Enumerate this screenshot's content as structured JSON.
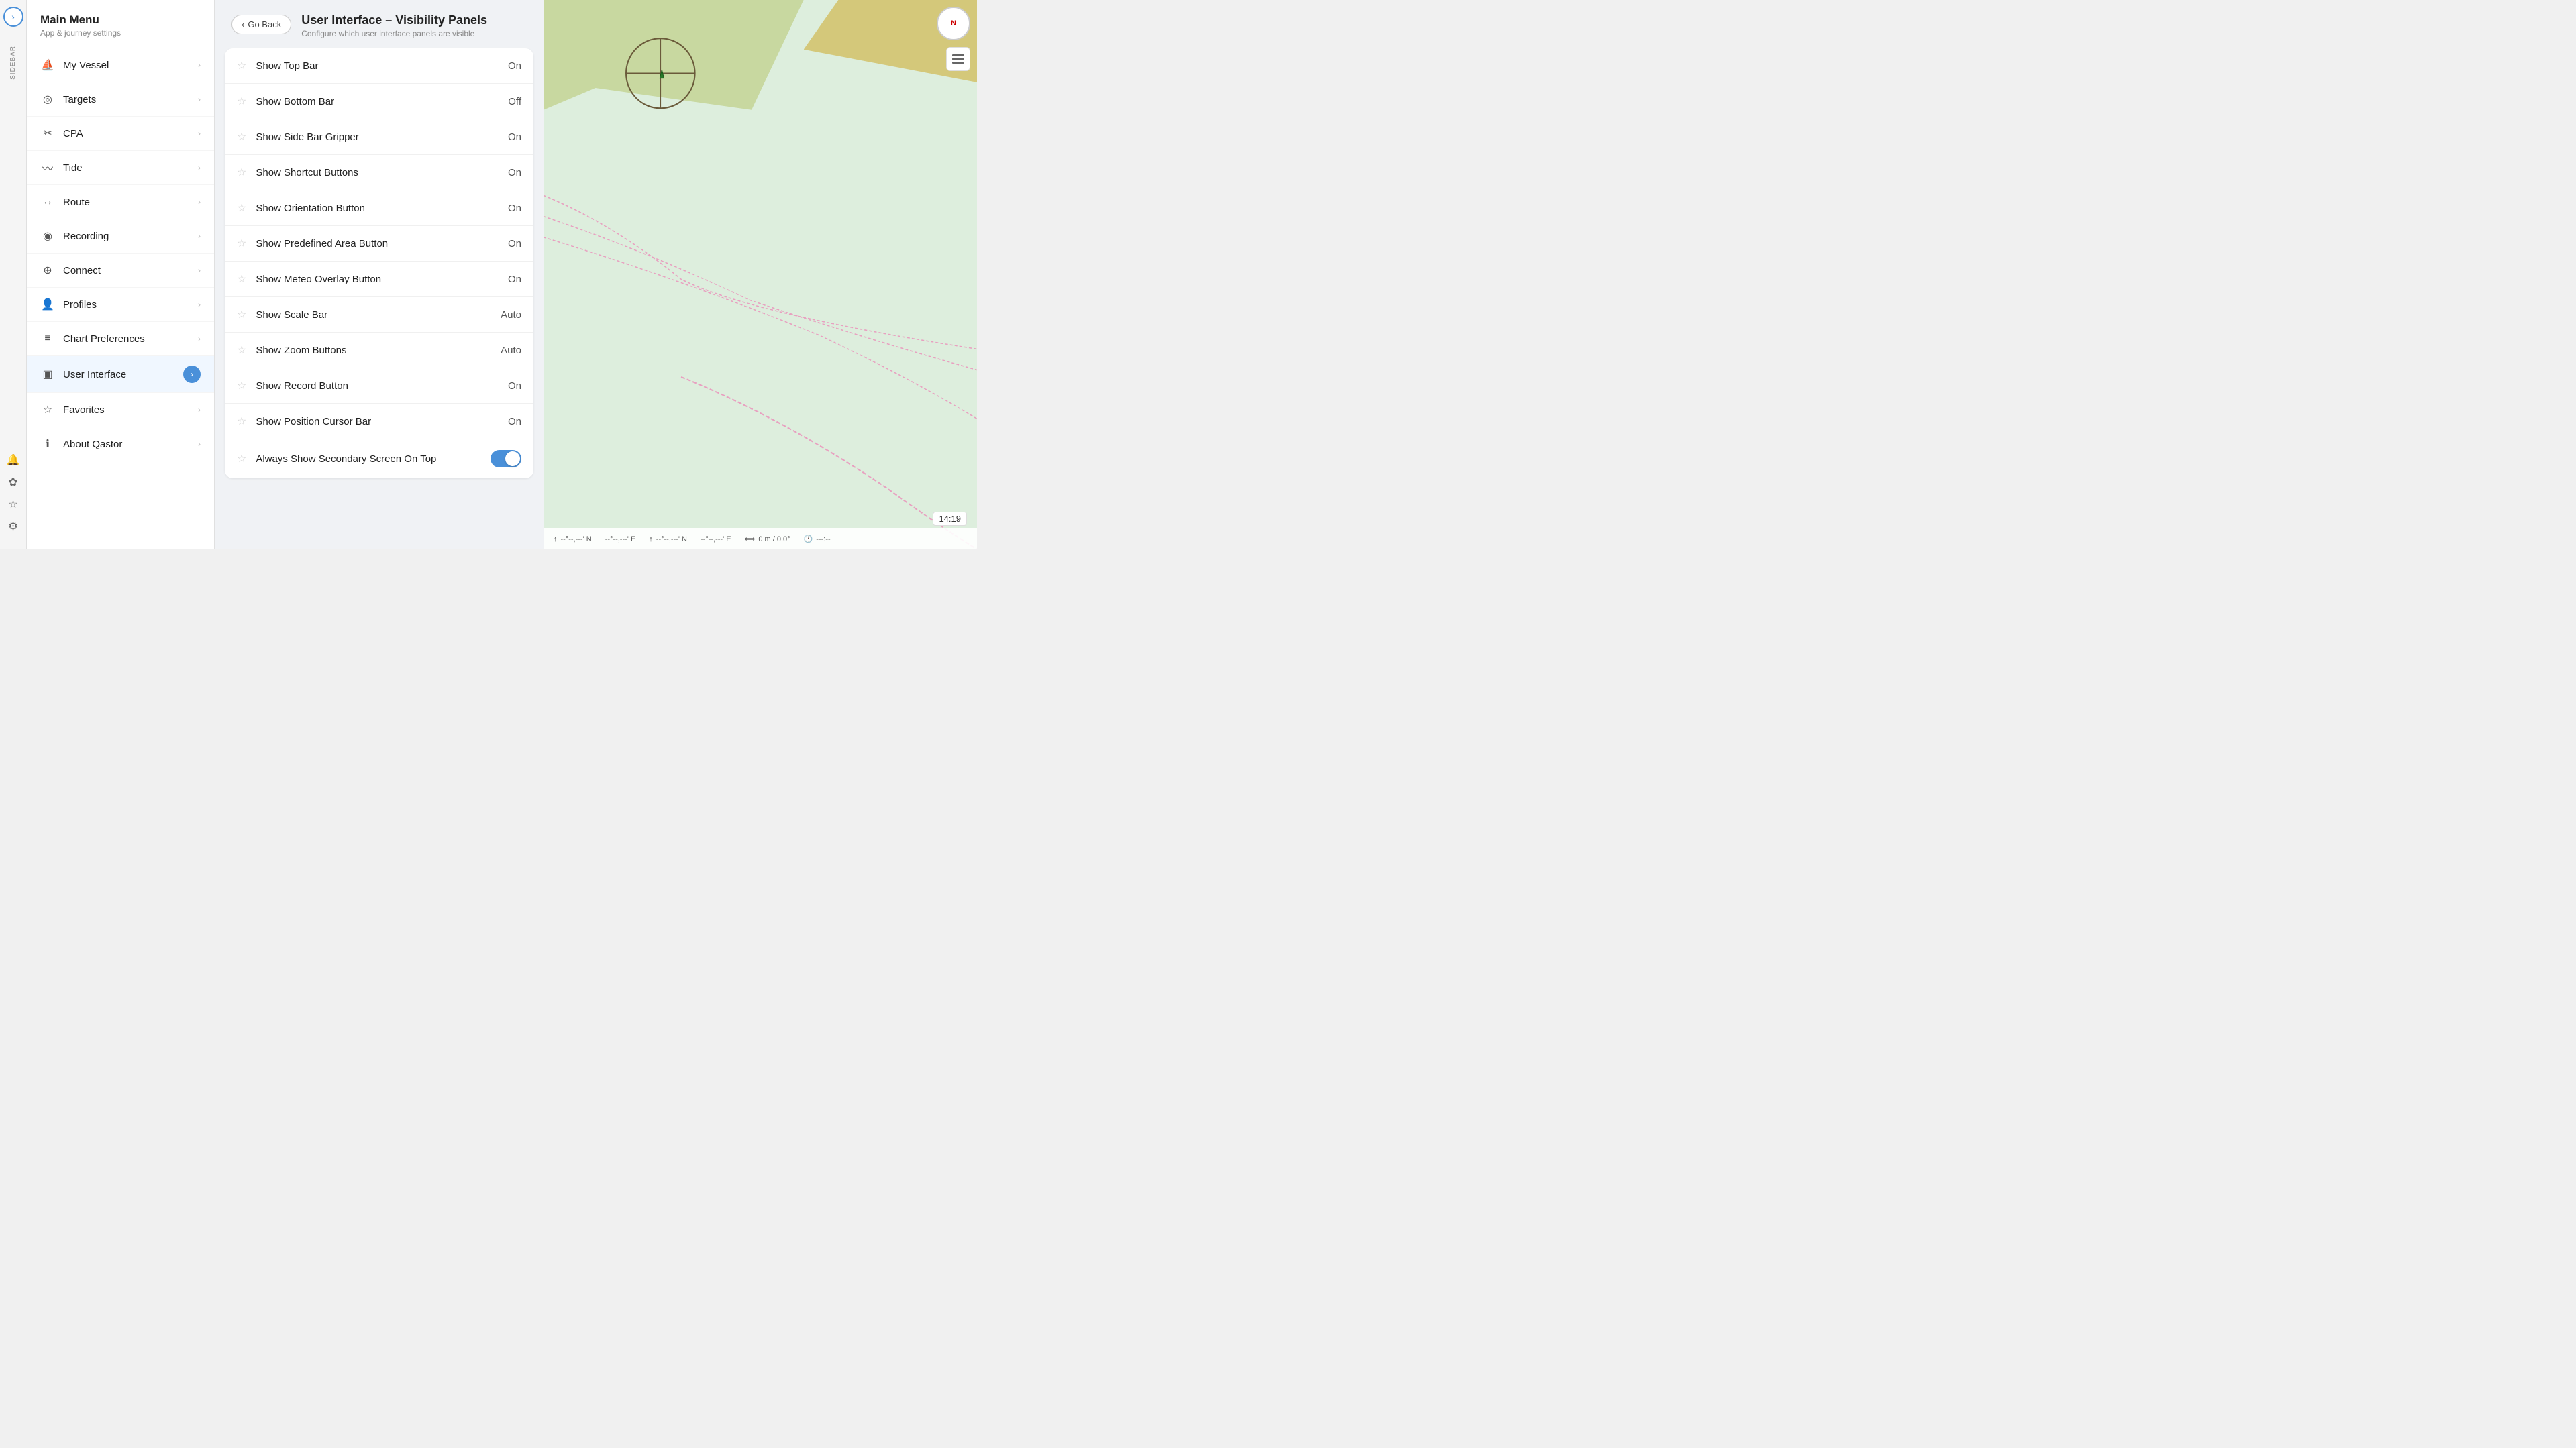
{
  "sidebar_strip": {
    "expand_icon": "›",
    "label": "SIDEBAR",
    "bell_icon": "🔔",
    "cog_icon": "⚙",
    "star_icon": "☆",
    "settings_icon": "⚙"
  },
  "left_panel": {
    "title": "Main Menu",
    "subtitle": "App & journey settings",
    "menu_items": [
      {
        "id": "my-vessel",
        "label": "My Vessel",
        "icon": "vessel"
      },
      {
        "id": "targets",
        "label": "Targets",
        "icon": "targets"
      },
      {
        "id": "cpa",
        "label": "CPA",
        "icon": "cpa"
      },
      {
        "id": "tide",
        "label": "Tide",
        "icon": "tide"
      },
      {
        "id": "route",
        "label": "Route",
        "icon": "route"
      },
      {
        "id": "recording",
        "label": "Recording",
        "icon": "recording"
      },
      {
        "id": "connect",
        "label": "Connect",
        "icon": "connect"
      },
      {
        "id": "profiles",
        "label": "Profiles",
        "icon": "profiles"
      },
      {
        "id": "chart-preferences",
        "label": "Chart Preferences",
        "icon": "chart-pref"
      },
      {
        "id": "user-interface",
        "label": "User Interface",
        "icon": "ui",
        "active": true
      },
      {
        "id": "favorites",
        "label": "Favorites",
        "icon": "favorites"
      },
      {
        "id": "about-qastor",
        "label": "About Qastor",
        "icon": "about"
      }
    ]
  },
  "center_panel": {
    "go_back_label": "Go Back",
    "title": "User Interface – Visibility Panels",
    "subtitle": "Configure which user interface panels are visible",
    "settings": [
      {
        "id": "show-top-bar",
        "label": "Show Top Bar",
        "value": "On",
        "type": "text"
      },
      {
        "id": "show-bottom-bar",
        "label": "Show Bottom Bar",
        "value": "Off",
        "type": "text"
      },
      {
        "id": "show-side-bar-gripper",
        "label": "Show Side Bar Gripper",
        "value": "On",
        "type": "text"
      },
      {
        "id": "show-shortcut-buttons",
        "label": "Show Shortcut Buttons",
        "value": "On",
        "type": "text"
      },
      {
        "id": "show-orientation-button",
        "label": "Show Orientation Button",
        "value": "On",
        "type": "text"
      },
      {
        "id": "show-predefined-area-button",
        "label": "Show Predefined Area Button",
        "value": "On",
        "type": "text"
      },
      {
        "id": "show-meteo-overlay-button",
        "label": "Show Meteo Overlay Button",
        "value": "On",
        "type": "text"
      },
      {
        "id": "show-scale-bar",
        "label": "Show Scale Bar",
        "value": "Auto",
        "type": "text"
      },
      {
        "id": "show-zoom-buttons",
        "label": "Show Zoom Buttons",
        "value": "Auto",
        "type": "text"
      },
      {
        "id": "show-record-button",
        "label": "Show Record Button",
        "value": "On",
        "type": "text"
      },
      {
        "id": "show-position-cursor-bar",
        "label": "Show Position Cursor Bar",
        "value": "On",
        "type": "text"
      },
      {
        "id": "always-show-secondary-screen",
        "label": "Always Show Secondary Screen On Top",
        "value": "toggle-on",
        "type": "toggle"
      }
    ]
  },
  "map": {
    "time_badge": "14:19",
    "compass_label": "N",
    "bottom_bar": [
      {
        "id": "coord1",
        "icon": "↑",
        "value": "--°--,---' N"
      },
      {
        "id": "coord2",
        "icon": "",
        "value": "--°--,---' E"
      },
      {
        "id": "coord3",
        "icon": "↑",
        "value": "--°--,---' N"
      },
      {
        "id": "coord4",
        "icon": "",
        "value": "--°--,---' E"
      },
      {
        "id": "speed",
        "icon": "⟺",
        "value": "0 m / 0.0°"
      },
      {
        "id": "time",
        "icon": "🕐",
        "value": "---:--"
      }
    ]
  }
}
